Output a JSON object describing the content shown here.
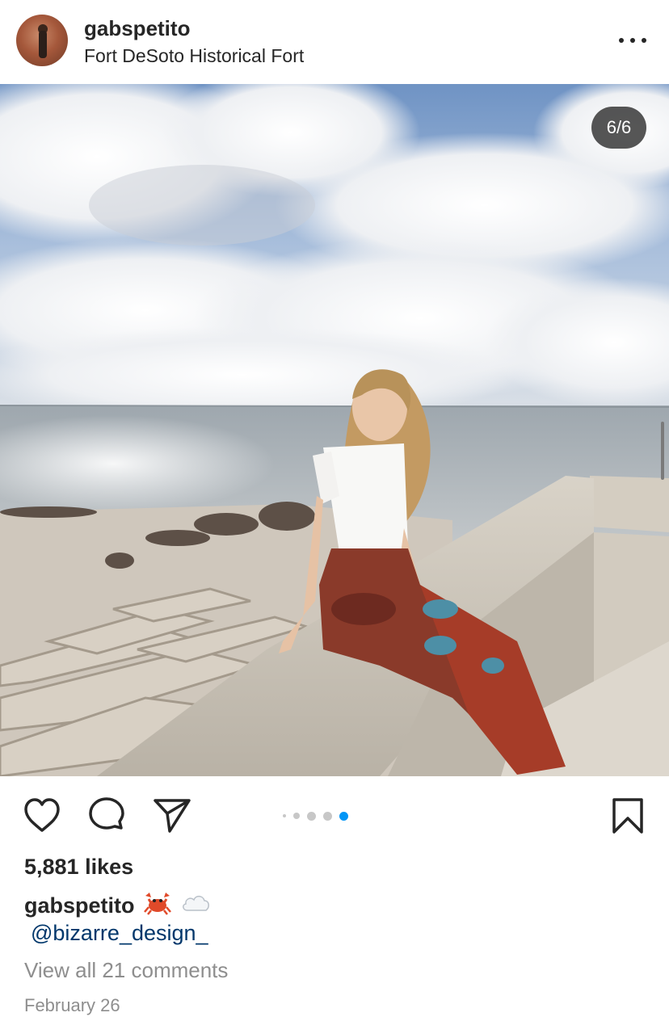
{
  "post": {
    "username": "gabspetito",
    "location": "Fort DeSoto Historical Fort",
    "image_counter": "6/6",
    "likes": "5,881 likes",
    "caption": {
      "username": "gabspetito",
      "emojis": [
        "crab-emoji",
        "cloud-emoji"
      ],
      "mention": "@bizarre_design_"
    },
    "comments_link": "View all 21 comments",
    "date": "February 26"
  },
  "carousel": {
    "total": 6,
    "active_index": 5
  },
  "colors": {
    "text": "#262626",
    "link": "#00376b",
    "muted": "#8e8e8e",
    "active_dot": "#0095f6",
    "inactive_dot": "#c7c7c7"
  },
  "icons": {
    "like": "heart-icon",
    "comment": "comment-icon",
    "share": "paper-plane-icon",
    "save": "bookmark-icon",
    "more": "more-options-icon"
  }
}
